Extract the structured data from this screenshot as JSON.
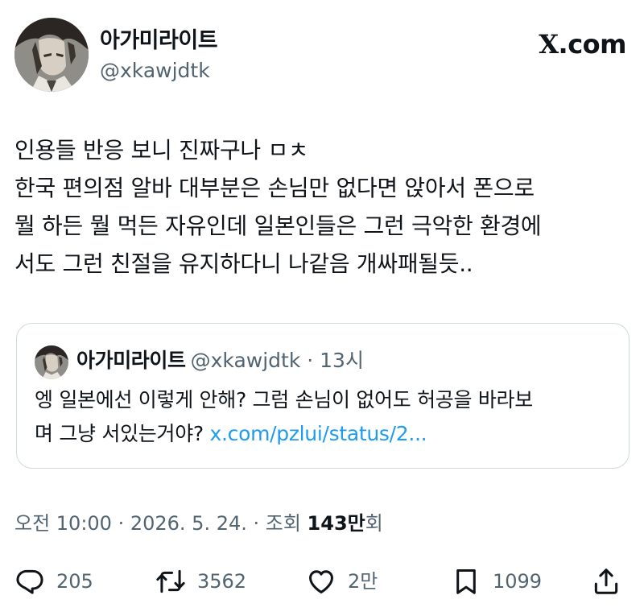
{
  "author": {
    "display_name": "아가미라이트",
    "handle": "@xkawjdtk"
  },
  "brand": {
    "text": ".com",
    "glyph": "X"
  },
  "tweet": {
    "lines": [
      "인용들 반응 보니 진짜구나 ㅁㅊ",
      "한국 편의점 알바 대부분은 손님만 없다면 앉아서 폰으로",
      "뭘 하든 뭘 먹든 자유인데 일본인들은 그런 극악한 환경에",
      "서도 그런 친절을 유지하다니 나같음 개싸패될듯.."
    ]
  },
  "quote": {
    "display_name": "아가미라이트",
    "meta": "@xkawjdtk · 13시",
    "line1": "엥 일본에선 이렇게 안해? 그럼 손님이 없어도 허공을 바라보",
    "line2_text": "며 그냥 서있는거야? ",
    "link": "x.com/pzlui/status/2..."
  },
  "timestamp": {
    "prefix": "오전 10:00 · 2026. 5. 24. · 조회 ",
    "views": "143만",
    "suffix": "회"
  },
  "actions": {
    "reply": {
      "icon": "reply-icon",
      "count": "205"
    },
    "retweet": {
      "icon": "retweet-icon",
      "count": "3562"
    },
    "like": {
      "icon": "heart-icon",
      "count": "2만"
    },
    "bookmark": {
      "icon": "bookmark-icon",
      "count": "1099"
    },
    "share": {
      "icon": "share-icon"
    }
  },
  "colors": {
    "text": "#0f1419",
    "secondary": "#536471",
    "link": "#1d9bf0",
    "border": "#cfd9de"
  }
}
